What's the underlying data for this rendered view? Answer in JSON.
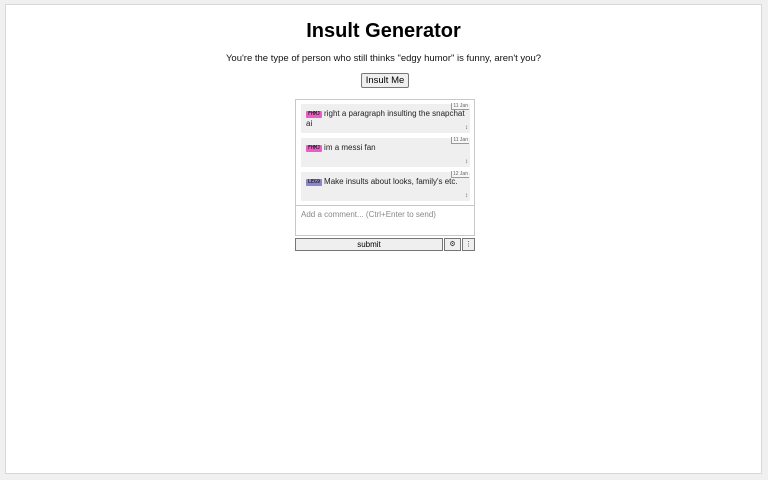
{
  "page": {
    "title": "Insult Generator",
    "insult": "You're the type of person who still thinks \"edgy humor\" is funny, aren't you?",
    "insult_button_label": "Insult Me"
  },
  "comments": {
    "items": [
      {
        "tag": "FHMJ",
        "tag_color": "#e75fc4",
        "text": "right a paragraph insulting the snapchat ai",
        "date": "11 Jan",
        "vote_icon": "vote-arrow-icon",
        "vote_glyph": "↕"
      },
      {
        "tag": "FHMJ",
        "tag_color": "#e75fc4",
        "text": "im a messi fan",
        "date": "11 Jan",
        "vote_icon": "vote-arrow-icon",
        "vote_glyph": "↕"
      },
      {
        "tag": "LEG9",
        "tag_color": "#8a86c9",
        "text": "Make insults about looks, family's etc.",
        "date": "12 Jan",
        "vote_icon": "vote-arrow-icon",
        "vote_glyph": "↕"
      }
    ],
    "input_placeholder": "Add a comment... (Ctrl+Enter to send)",
    "submit_label": "submit",
    "settings_icon": "gear-icon",
    "settings_glyph": "⚙",
    "menu_icon": "menu-icon",
    "menu_glyph": "⋮"
  }
}
